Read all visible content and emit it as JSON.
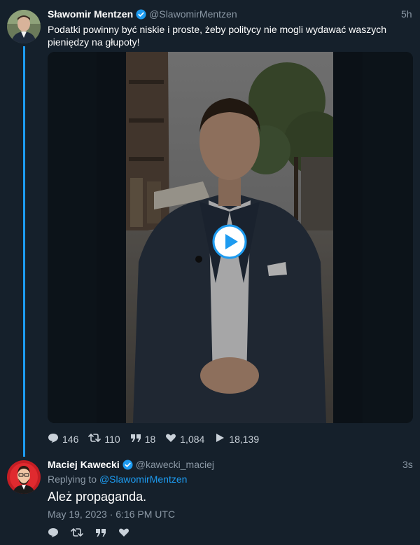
{
  "tweet": {
    "author_name": "Sławomir Mentzen",
    "handle": "@SlawomirMentzen",
    "time_ago": "5h",
    "text": "Podatki powinny być niskie i proste, żeby politycy nie mogli wydawać waszych pieniędzy na głupoty!",
    "media": {
      "type": "video",
      "play_icon": "play-icon"
    },
    "stats": {
      "replies": "146",
      "retweets": "110",
      "quotes": "18",
      "likes": "1,084",
      "views": "18,139"
    }
  },
  "reply": {
    "author_name": "Maciej Kawecki",
    "handle": "@kawecki_maciej",
    "time_ago": "3s",
    "replying_prefix": "Replying to",
    "replying_to": "@SlawomirMentzen",
    "text": "Ależ propaganda.",
    "timestamp": "May 19, 2023 · 6:16 PM UTC"
  },
  "colors": {
    "background": "#15202b",
    "accent": "#1d9bf0",
    "muted": "#8b98a5",
    "text": "#ffffff"
  },
  "icons": [
    "verified-badge-icon",
    "reply-icon",
    "retweet-icon",
    "quote-icon",
    "like-icon",
    "views-icon",
    "play-icon"
  ]
}
